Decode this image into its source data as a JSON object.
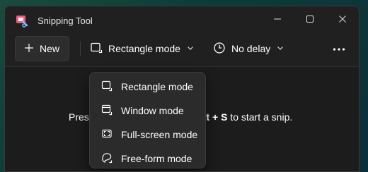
{
  "window": {
    "title": "Snipping Tool"
  },
  "toolbar": {
    "new_label": "New",
    "mode_label": "Rectangle mode",
    "delay_label": "No delay"
  },
  "content": {
    "hint_start": "Pres",
    "hint_keys": "ft + S",
    "hint_end": " to start a snip."
  },
  "mode_menu": {
    "items": [
      {
        "label": "Rectangle mode",
        "icon": "rectangle-mode-icon"
      },
      {
        "label": "Window mode",
        "icon": "window-mode-icon"
      },
      {
        "label": "Full-screen mode",
        "icon": "fullscreen-mode-icon"
      },
      {
        "label": "Free-form mode",
        "icon": "freeform-mode-icon"
      }
    ]
  },
  "colors": {
    "background": "#1f1f1f",
    "menu": "#2b2b2b",
    "text": "#ffffff"
  }
}
